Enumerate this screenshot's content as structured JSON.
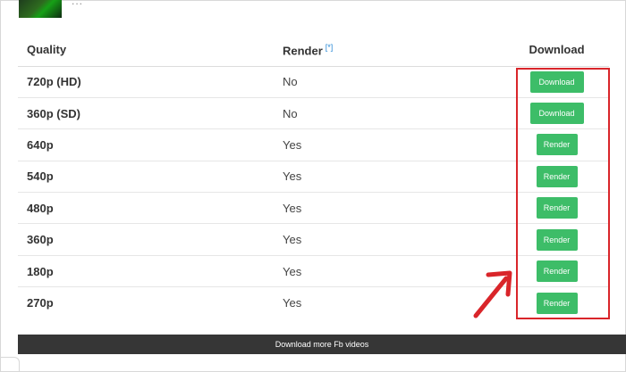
{
  "header": {
    "thumbnail_extra": "..."
  },
  "table": {
    "columns": {
      "quality": "Quality",
      "render": "Render",
      "render_hint": "[*]",
      "download": "Download"
    },
    "rows": [
      {
        "quality": "720p (HD)",
        "render": "No",
        "action": "Download"
      },
      {
        "quality": "360p (SD)",
        "render": "No",
        "action": "Download"
      },
      {
        "quality": "640p",
        "render": "Yes",
        "action": "Render"
      },
      {
        "quality": "540p",
        "render": "Yes",
        "action": "Render"
      },
      {
        "quality": "480p",
        "render": "Yes",
        "action": "Render"
      },
      {
        "quality": "360p",
        "render": "Yes",
        "action": "Render"
      },
      {
        "quality": "180p",
        "render": "Yes",
        "action": "Render"
      },
      {
        "quality": "270p",
        "render": "Yes",
        "action": "Render"
      }
    ]
  },
  "footer": {
    "more_videos_label": "Download more Fb videos"
  },
  "colors": {
    "button_green": "#3dbd68",
    "highlight_red": "#d9252a",
    "footer_bar": "#363636",
    "hint_blue": "#2a8ad6"
  }
}
